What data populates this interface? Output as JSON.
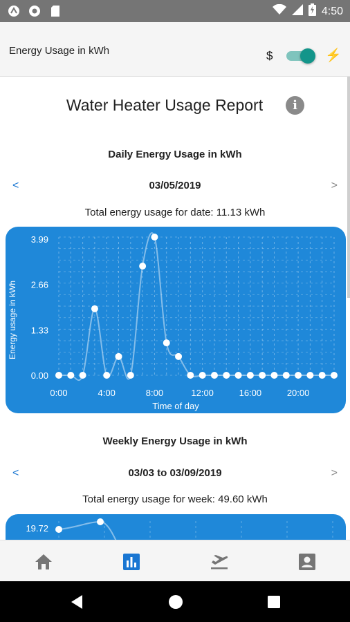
{
  "status_bar": {
    "time": "4:50"
  },
  "app_bar": {
    "title": "Energy Usage in kWh",
    "currency_symbol": "$"
  },
  "report": {
    "title": "Water Heater Usage Report",
    "daily": {
      "section_title": "Daily Energy Usage in kWh",
      "prev": "<",
      "next": ">",
      "date": "03/05/2019",
      "total": "Total energy usage for date: 11.13 kWh"
    },
    "weekly": {
      "section_title": "Weekly Energy Usage in kWh",
      "prev": "<",
      "next": ">",
      "date_range": "03/03 to 03/09/2019",
      "total": "Total energy usage for week: 49.60 kWh"
    }
  },
  "chart_data": [
    {
      "type": "line",
      "title": "",
      "xlabel": "Time of day",
      "ylabel": "Energy usage in kWh",
      "x": [
        0,
        1,
        2,
        3,
        4,
        5,
        6,
        7,
        8,
        9,
        10,
        11,
        12,
        13,
        14,
        15,
        16,
        17,
        18,
        19,
        20,
        21,
        22,
        23
      ],
      "y": [
        0,
        0,
        0,
        1.95,
        0,
        0.55,
        0,
        3.2,
        4.05,
        0.95,
        0.55,
        0,
        0,
        0,
        0,
        0,
        0,
        0,
        0,
        0,
        0,
        0,
        0,
        0
      ],
      "xticks": [
        "0:00",
        "4:00",
        "8:00",
        "12:00",
        "16:00",
        "20:00"
      ],
      "xtick_values": [
        0,
        4,
        8,
        12,
        16,
        20
      ],
      "yticks": [
        "0.00",
        "1.33",
        "2.66",
        "3.99"
      ],
      "ytick_values": [
        0,
        1.33,
        2.66,
        3.99
      ],
      "xlim": [
        0,
        23
      ],
      "ylim": [
        0,
        4.05
      ],
      "grid": true,
      "color": "#1f88d9"
    },
    {
      "type": "line",
      "title": "",
      "yticks": [
        "19.72"
      ],
      "ytick_values": [
        19.72
      ],
      "x": [
        0,
        1
      ],
      "y": [
        19.72,
        21.2
      ],
      "partial": true
    }
  ],
  "bottom_nav": {
    "items": [
      {
        "icon": "home-icon",
        "active": false
      },
      {
        "icon": "bar-chart-icon",
        "active": true
      },
      {
        "icon": "departure-icon",
        "active": false
      },
      {
        "icon": "account-box-icon",
        "active": false
      }
    ],
    "active_color": "#1976d2",
    "inactive_color": "#757575"
  }
}
